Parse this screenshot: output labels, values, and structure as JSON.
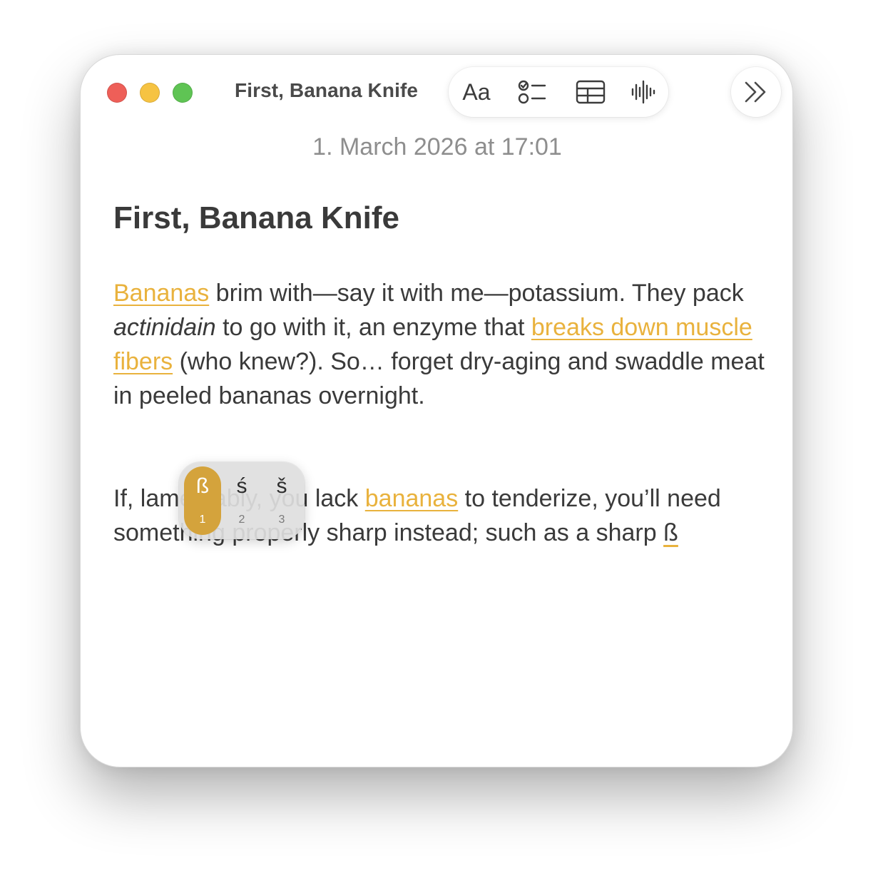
{
  "window": {
    "title": "First, Banana Knife",
    "controls": [
      "close",
      "minimize",
      "maximize"
    ]
  },
  "toolbar": {
    "format_label": "Aa",
    "checklist_icon": "checklist-icon",
    "table_icon": "table-icon",
    "audio_icon": "waveform-icon",
    "more_icon": "double-chevron-right-icon"
  },
  "note": {
    "date": "1. March 2026 at 17:01",
    "heading": "First, Banana Knife",
    "p1": {
      "link1": "Bananas",
      "t1": " brim with—say it with me—potassium. They pack ",
      "em": "actinidain",
      "t2": " to go with it, an enzyme that ",
      "link2": "breaks down muscle fibers",
      "t3": " (who knew?). So… forget dry-aging and swaddle meat in peeled bananas overnight."
    },
    "p2": {
      "t1": "If, lamentably, you lack ",
      "link": "bananas",
      "t2": " to tenderize, you’ll need something properly sharp instead; such as a sharp ",
      "marked": "ß"
    }
  },
  "accent_popup": {
    "options": [
      {
        "char": "ß",
        "number": "1",
        "selected": true
      },
      {
        "char": "ś",
        "number": "2",
        "selected": false
      },
      {
        "char": "š",
        "number": "3",
        "selected": false
      }
    ]
  },
  "colors": {
    "accent": "#e9b23d",
    "selected_option": "#d4a33c",
    "close": "#ee5f58",
    "minimize": "#f6c342",
    "maximize": "#5fc454"
  }
}
